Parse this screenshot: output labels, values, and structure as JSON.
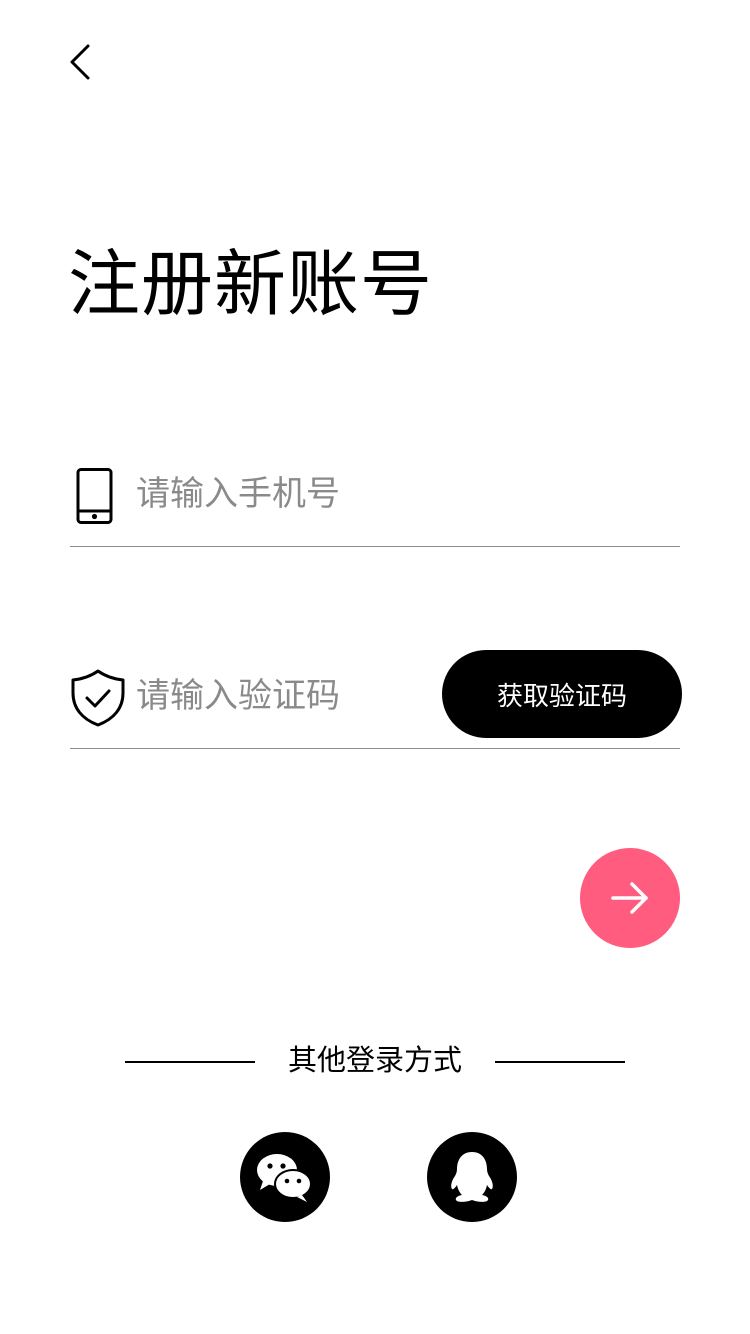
{
  "header": {
    "back_icon": "chevron-left-icon"
  },
  "page": {
    "title": "注册新账号"
  },
  "form": {
    "phone": {
      "icon": "phone-icon",
      "placeholder": "请输入手机号",
      "value": ""
    },
    "code": {
      "icon": "shield-check-icon",
      "placeholder": "请输入验证码",
      "value": ""
    },
    "get_code_label": "获取验证码",
    "submit_icon": "arrow-right-icon"
  },
  "other_login": {
    "label": "其他登录方式",
    "options": [
      {
        "icon": "wechat-icon"
      },
      {
        "icon": "qq-icon"
      }
    ]
  },
  "colors": {
    "accent": "#ff5c7f",
    "primary": "#000000",
    "divider": "#8c8c8c",
    "placeholder": "#8a8a8a"
  }
}
